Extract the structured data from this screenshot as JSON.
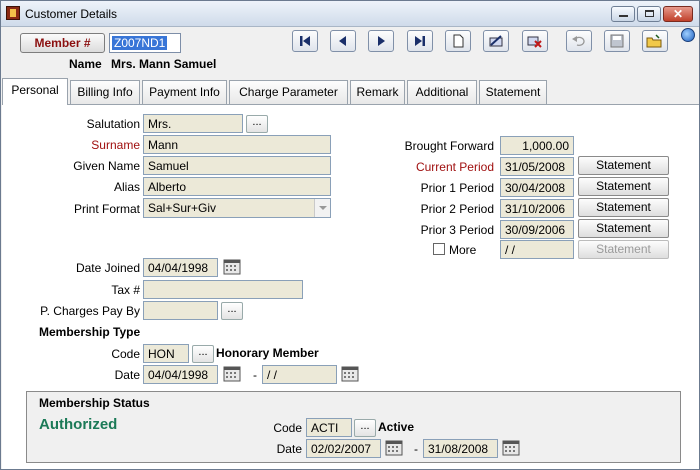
{
  "window": {
    "title": "Customer Details"
  },
  "header": {
    "member_button": "Member #",
    "member_id": "Z007ND1",
    "name_label": "Name",
    "name_value": "Mrs. Mann Samuel"
  },
  "tabs": [
    "Personal",
    "Billing Info",
    "Payment Info",
    "Charge Parameter",
    "Remark",
    "Additional",
    "Statement"
  ],
  "active_tab": "Personal",
  "personal": {
    "salutation_label": "Salutation",
    "salutation": "Mrs.",
    "surname_label": "Surname",
    "surname": "Mann",
    "given_name_label": "Given Name",
    "given_name": "Samuel",
    "alias_label": "Alias",
    "alias": "Alberto",
    "print_format_label": "Print Format",
    "print_format": "Sal+Sur+Giv",
    "date_joined_label": "Date Joined",
    "date_joined": "04/04/1998",
    "tax_label": "Tax #",
    "tax": "",
    "pcharges_label": "P. Charges Pay By",
    "pcharges": ""
  },
  "balances": {
    "brought_forward_label": "Brought Forward",
    "brought_forward": "1,000.00",
    "current_label": "Current Period",
    "current": "31/05/2008",
    "prior1_label": "Prior 1 Period",
    "prior1": "30/04/2008",
    "prior2_label": "Prior 2 Period",
    "prior2": "31/10/2006",
    "prior3_label": "Prior 3 Period",
    "prior3": "30/09/2006",
    "more_label": "More",
    "more": " / /",
    "statement_label": "Statement"
  },
  "membership_type": {
    "heading": "Membership Type",
    "code_label": "Code",
    "code": "HON",
    "code_desc": "Honorary Member",
    "date_label": "Date",
    "date_from": "04/04/1998",
    "sep": "-",
    "date_to": " / /"
  },
  "membership_status": {
    "heading": "Membership Status",
    "status": "Authorized",
    "code_label": "Code",
    "code": "ACTI",
    "code_desc": "Active",
    "date_label": "Date",
    "date_from": "02/02/2007",
    "sep": "-",
    "date_to": "31/08/2008"
  },
  "toolbar_icons": [
    "first-record-icon",
    "prev-record-icon",
    "next-record-icon",
    "last-record-icon",
    "new-document-icon",
    "edit-icon",
    "delete-icon",
    "undo-icon",
    "save-icon",
    "open-folder-icon",
    "help-globe-icon"
  ],
  "colors": {
    "field_bg": "#ece9d8",
    "label_red": "#a01010",
    "authorized_green": "#1b7a57",
    "member_red": "#8b1010"
  }
}
